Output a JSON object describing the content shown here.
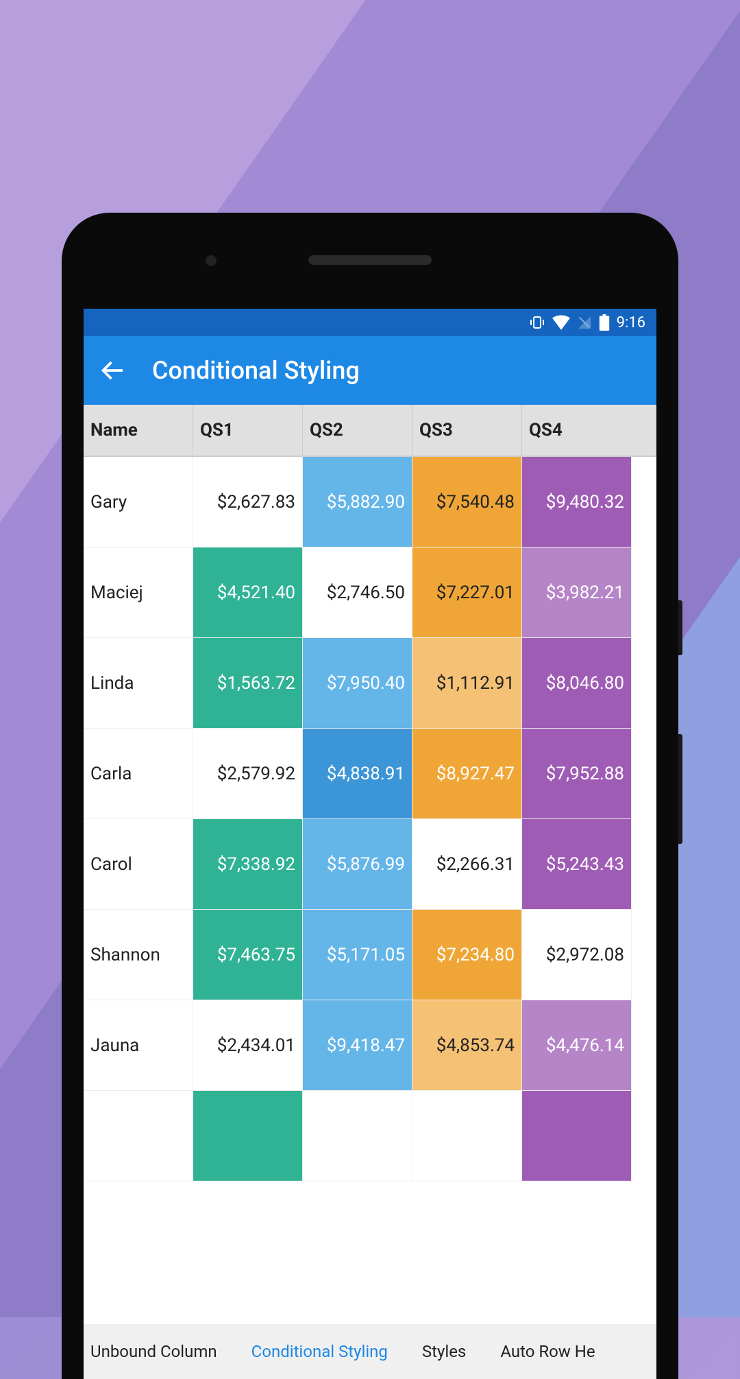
{
  "status": {
    "time": "9:16"
  },
  "header": {
    "title": "Conditional Styling"
  },
  "columns": [
    "Name",
    "QS1",
    "QS2",
    "QS3",
    "QS4"
  ],
  "rows": [
    {
      "name": "Gary",
      "qs1": "$2,627.83",
      "qs2": "$5,882.90",
      "qs3": "$7,540.48",
      "qs4": "$9,480.32",
      "style": {
        "qs1": "",
        "qs2": "c-lblue",
        "qs3": "c-orangetxt",
        "qs4": "c-purple"
      }
    },
    {
      "name": "Maciej",
      "qs1": "$4,521.40",
      "qs2": "$2,746.50",
      "qs3": "$7,227.01",
      "qs4": "$3,982.21",
      "style": {
        "qs1": "c-green",
        "qs2": "",
        "qs3": "c-orangetxt",
        "qs4": "c-lpurple"
      }
    },
    {
      "name": "Linda",
      "qs1": "$1,563.72",
      "qs2": "$7,950.40",
      "qs3": "$1,112.91",
      "qs4": "$8,046.80",
      "style": {
        "qs1": "c-green",
        "qs2": "c-lblue",
        "qs3": "c-lorangetxt",
        "qs4": "c-purple"
      }
    },
    {
      "name": "Carla",
      "qs1": "$2,579.92",
      "qs2": "$4,838.91",
      "qs3": "$8,927.47",
      "qs4": "$7,952.88",
      "style": {
        "qs1": "",
        "qs2": "c-blue",
        "qs3": "c-orange",
        "qs4": "c-purple"
      }
    },
    {
      "name": "Carol",
      "qs1": "$7,338.92",
      "qs2": "$5,876.99",
      "qs3": "$2,266.31",
      "qs4": "$5,243.43",
      "style": {
        "qs1": "c-green",
        "qs2": "c-lblue",
        "qs3": "",
        "qs4": "c-purple"
      }
    },
    {
      "name": "Shannon",
      "qs1": "$7,463.75",
      "qs2": "$5,171.05",
      "qs3": "$7,234.80",
      "qs4": "$2,972.08",
      "style": {
        "qs1": "c-green",
        "qs2": "c-lblue",
        "qs3": "c-orange",
        "qs4": ""
      }
    },
    {
      "name": "Jauna",
      "qs1": "$2,434.01",
      "qs2": "$9,418.47",
      "qs3": "$4,853.74",
      "qs4": "$4,476.14",
      "style": {
        "qs1": "",
        "qs2": "c-lblue",
        "qs3": "c-lorangetxt",
        "qs4": "c-lpurple"
      }
    },
    {
      "name": "",
      "qs1": "",
      "qs2": "",
      "qs3": "",
      "qs4": "",
      "style": {
        "qs1": "c-green",
        "qs2": "",
        "qs3": "",
        "qs4": "c-purple"
      }
    }
  ],
  "tabs": {
    "items": [
      "Unbound Column",
      "Conditional Styling",
      "Styles",
      "Auto Row He"
    ],
    "active": 1
  }
}
